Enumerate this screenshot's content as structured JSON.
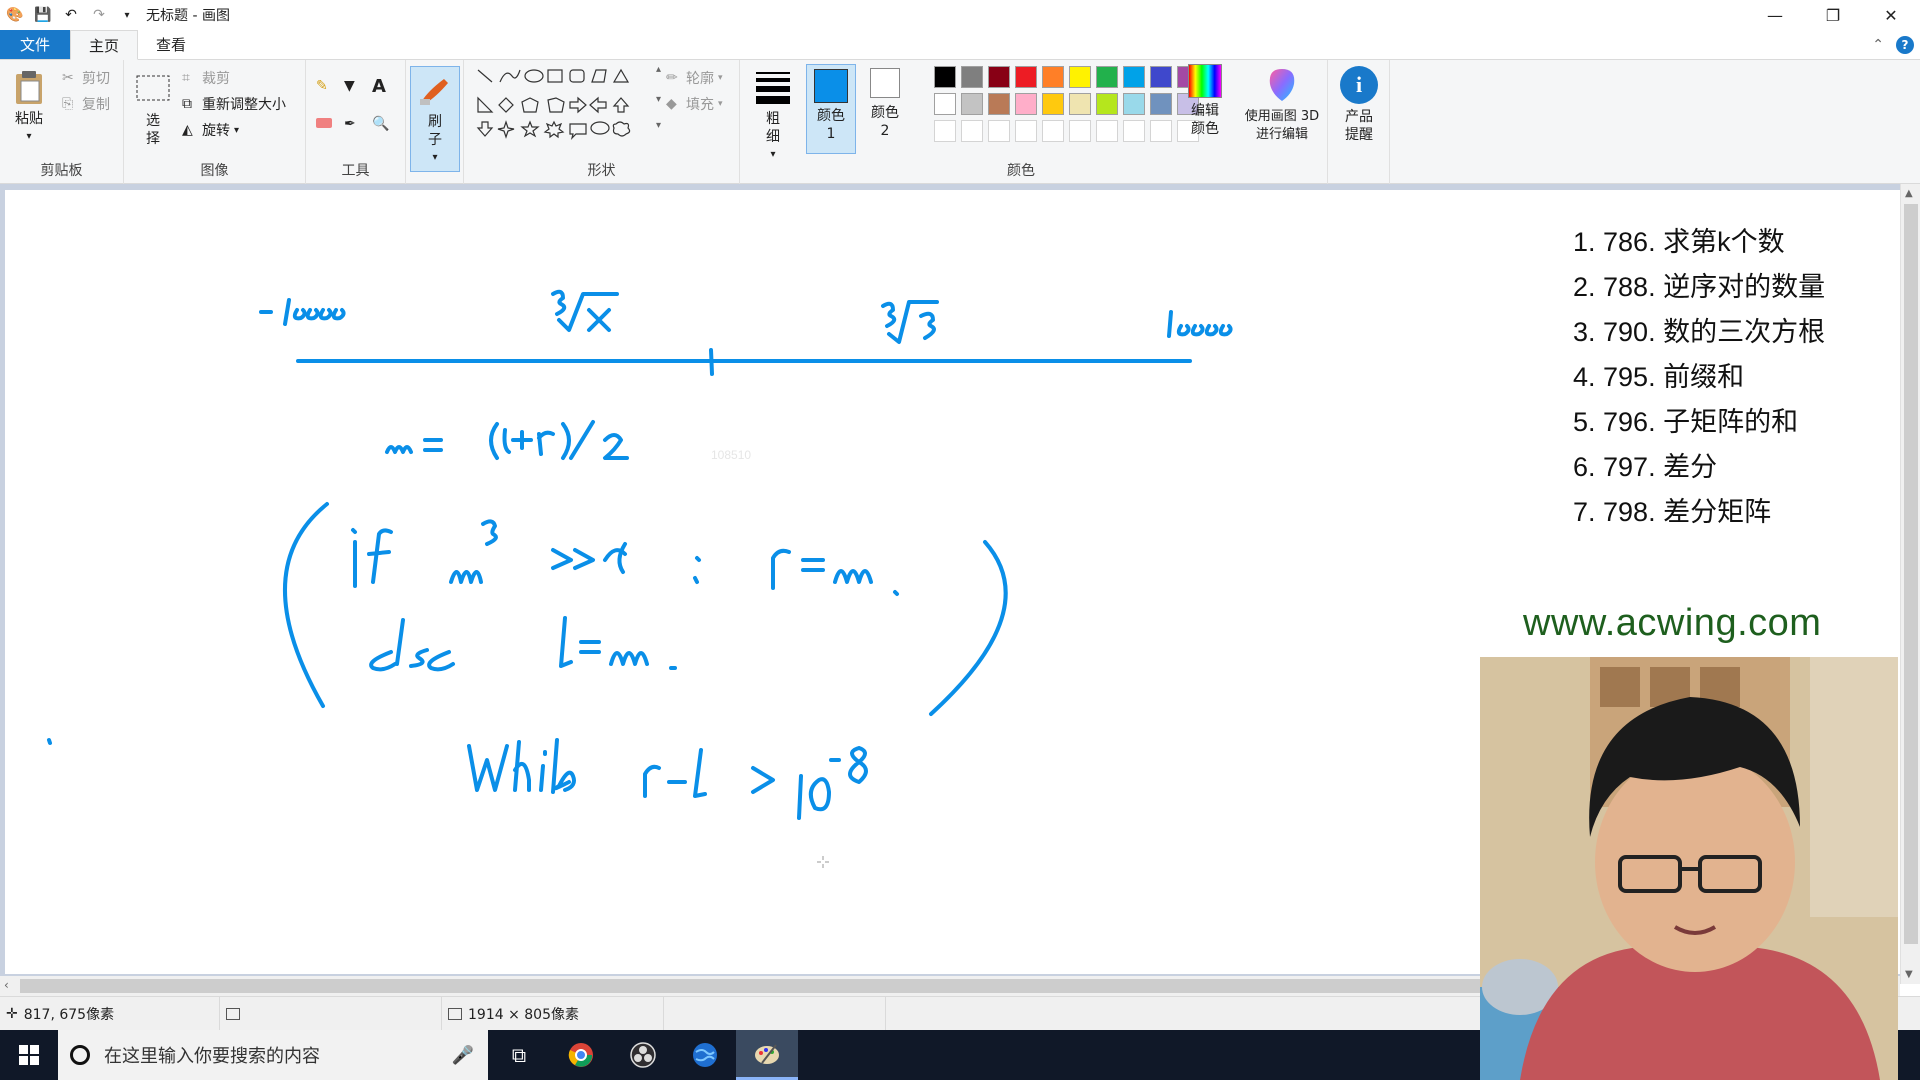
{
  "window": {
    "title": "无标题 - 画图",
    "controls": [
      "—",
      "❐",
      "✕"
    ]
  },
  "tabs": {
    "file": "文件",
    "home": "主页",
    "view": "查看"
  },
  "clipboard": {
    "paste": "粘贴",
    "cut": "剪切",
    "copy": "复制",
    "label": "剪贴板"
  },
  "image": {
    "select": "选择",
    "crop": "裁剪",
    "resize": "重新调整大小",
    "rotate": "旋转",
    "label": "图像"
  },
  "tools": {
    "label": "工具"
  },
  "brushes": {
    "label": "刷子"
  },
  "shapes": {
    "outline": "轮廓",
    "fill": "填充",
    "label": "形状"
  },
  "size": {
    "label": "粗细"
  },
  "colors": {
    "color1": "颜色 1",
    "color2": "颜色 2",
    "edit": "编辑颜色",
    "label": "颜色",
    "color1_value": "#0a8fe8",
    "row1": [
      "#000000",
      "#7f7f7f",
      "#880015",
      "#ed1c24",
      "#ff7f27",
      "#fff200",
      "#22b14c",
      "#00a2e8",
      "#3f48cc",
      "#a349a4"
    ],
    "row2": [
      "#ffffff",
      "#c3c3c3",
      "#b97a57",
      "#ffaec9",
      "#ffc90e",
      "#efe4b0",
      "#b5e61d",
      "#99d9ea",
      "#7092be",
      "#c8bfe7"
    ]
  },
  "paint3d": {
    "label": "使用画图 3D 进行编辑"
  },
  "tips": {
    "label": "产品提醒"
  },
  "canvas": {
    "problems": [
      "1. 786. 求第k个数",
      "2. 788. 逆序对的数量",
      "3. 790. 数的三次方根",
      "4. 795. 前缀和",
      "5. 796. 子矩阵的和",
      "6. 797. 差分",
      "7. 798. 差分矩阵"
    ],
    "website": "www.acwing.com",
    "ink_color": "#0a8fe8"
  },
  "status": {
    "cursor": "817, 675像素",
    "canvas_size": "1914 × 805像素"
  },
  "taskbar": {
    "search_placeholder": "在这里输入你要搜索的内容"
  }
}
